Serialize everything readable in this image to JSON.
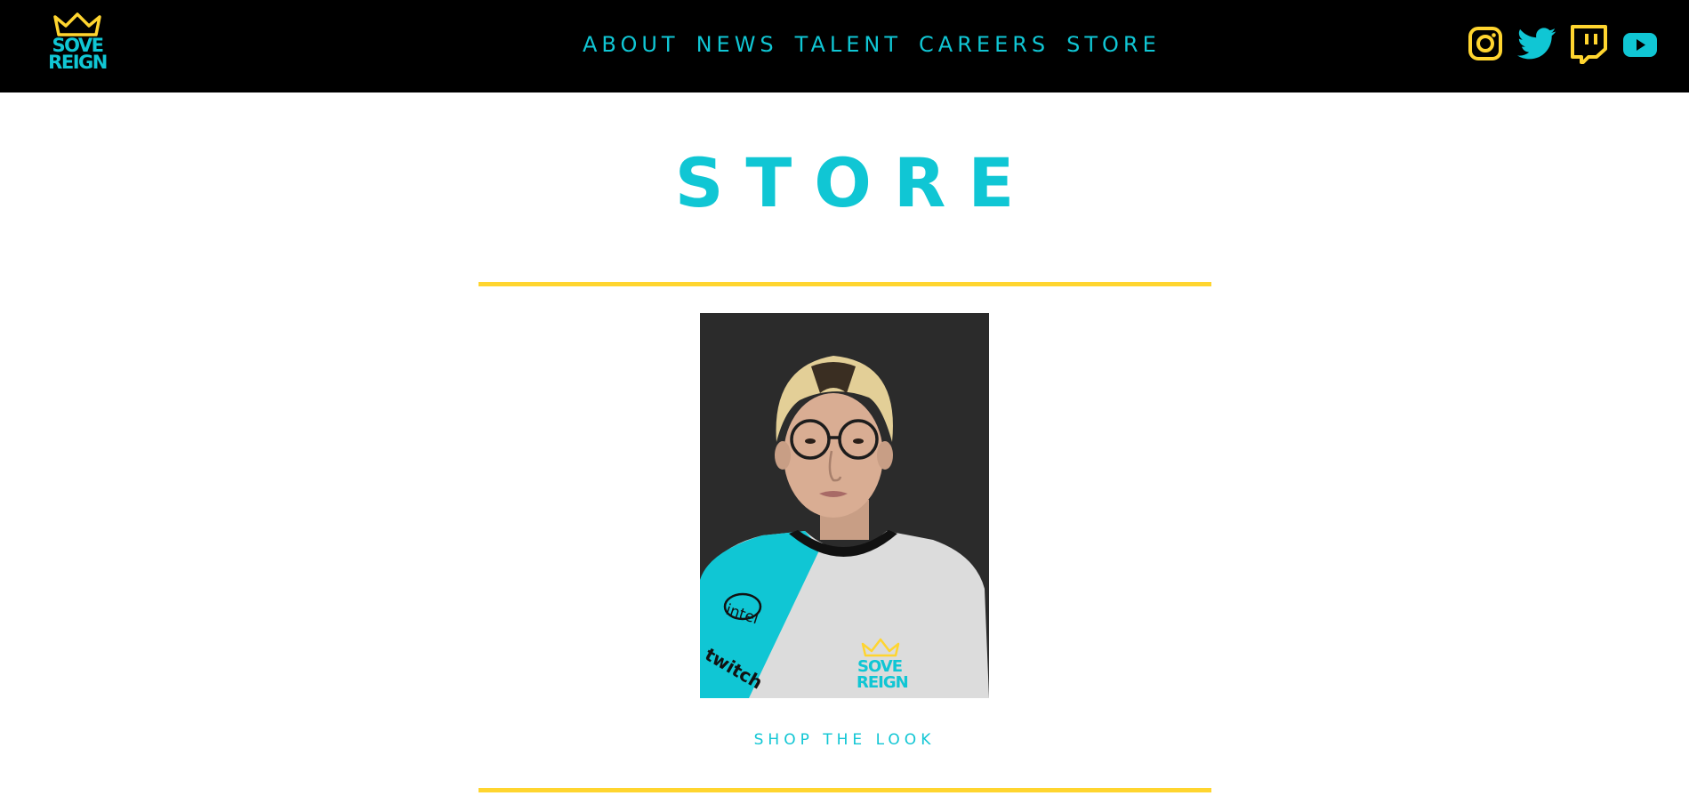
{
  "brand": {
    "logo_text": [
      "SOVE",
      "REIGN"
    ],
    "primary_color": "#10c6d4",
    "accent_color": "#ffd52f",
    "header_bg": "#000000"
  },
  "nav": {
    "items": [
      {
        "label": "ABOUT"
      },
      {
        "label": "NEWS"
      },
      {
        "label": "TALENT"
      },
      {
        "label": "CAREERS"
      },
      {
        "label": "STORE"
      }
    ]
  },
  "social": [
    {
      "icon": "instagram-icon",
      "color": "#ffd52f"
    },
    {
      "icon": "twitter-icon",
      "color": "#10c6d4"
    },
    {
      "icon": "twitch-icon",
      "color": "#ffd52f"
    },
    {
      "icon": "youtube-icon",
      "color": "#10c6d4"
    }
  ],
  "main": {
    "title": "STORE",
    "product": {
      "jersey_logo_text": [
        "SOVE",
        "REIGN"
      ],
      "sponsor_texts": [
        "intel",
        "twitch"
      ],
      "cta": "SHOP THE LOOK"
    }
  }
}
